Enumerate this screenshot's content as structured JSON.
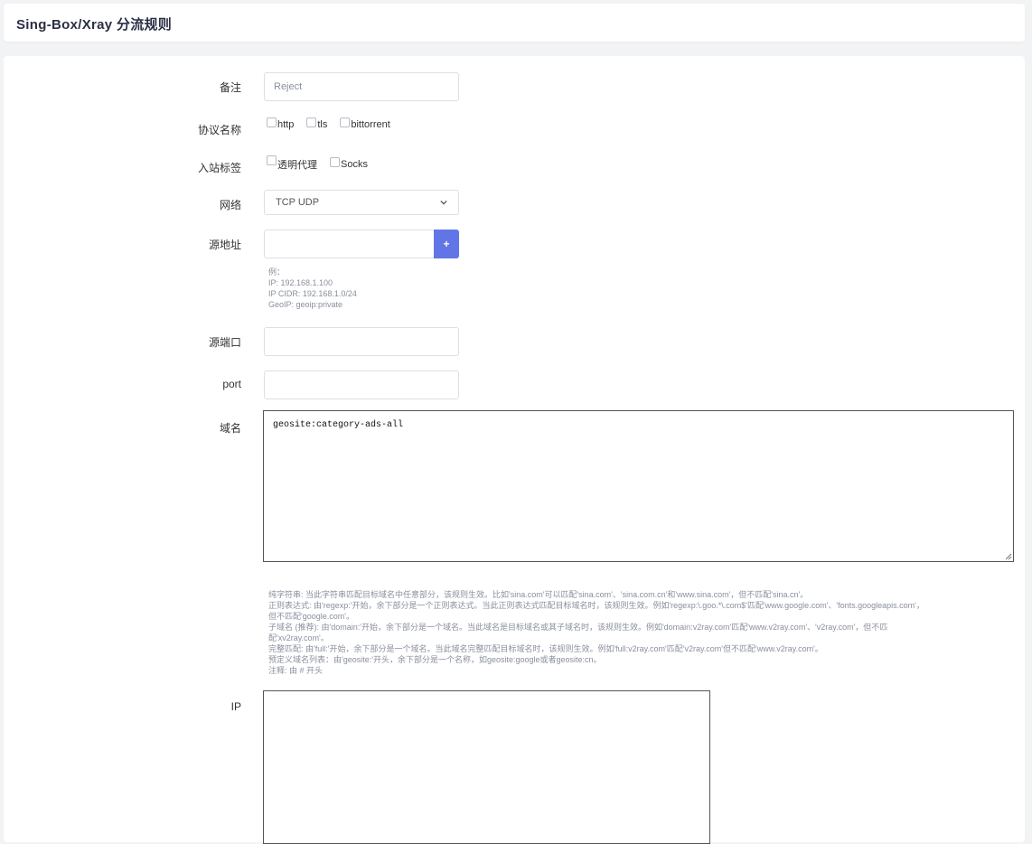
{
  "page": {
    "title": "Sing-Box/Xray 分流规则"
  },
  "form": {
    "remark": {
      "label": "备注",
      "placeholder": "Reject"
    },
    "protocol": {
      "label": "协议名称",
      "options": [
        "http",
        "tls",
        "bittorrent"
      ]
    },
    "inbound": {
      "label": "入站标签",
      "options": [
        "透明代理",
        "Socks"
      ]
    },
    "network": {
      "label": "网络",
      "value": "TCP UDP"
    },
    "source": {
      "label": "源地址",
      "add_label": "+",
      "hint": "例：\nIP: 192.168.1.100\nIP CIDR: 192.168.1.0/24\nGeoIP: geoip:private"
    },
    "source_port": {
      "label": "源端口"
    },
    "port": {
      "label": "port"
    },
    "domain": {
      "label": "域名",
      "value": "geosite:category-ads-all",
      "hint": "纯字符串: 当此字符串匹配目标域名中任意部分，该规则生效。比如'sina.com'可以匹配'sina.com'、'sina.com.cn'和'www.sina.com'，但不匹配'sina.cn'。\n正则表达式: 由'regexp:'开始，余下部分是一个正则表达式。当此正则表达式匹配目标域名时，该规则生效。例如'regexp:\\.goo.*\\.com$'匹配'www.google.com'、'fonts.googleapis.com'，\n但不匹配'google.com'。\n子域名 (推荐): 由'domain:'开始，余下部分是一个域名。当此域名是目标域名或其子域名时，该规则生效。例如'domain:v2ray.com'匹配'www.v2ray.com'、'v2ray.com'，但不匹\n配'xv2ray.com'。\n完整匹配: 由'full:'开始，余下部分是一个域名。当此域名完整匹配目标域名时，该规则生效。例如'full:v2ray.com'匹配'v2ray.com'但不匹配'www.v2ray.com'。\n预定义域名列表：由'geosite:'开头，余下部分是一个名称，如geosite:google或者geosite:cn。\n注释: 由 # 开头"
    },
    "ip": {
      "label": "IP",
      "value": ""
    }
  }
}
